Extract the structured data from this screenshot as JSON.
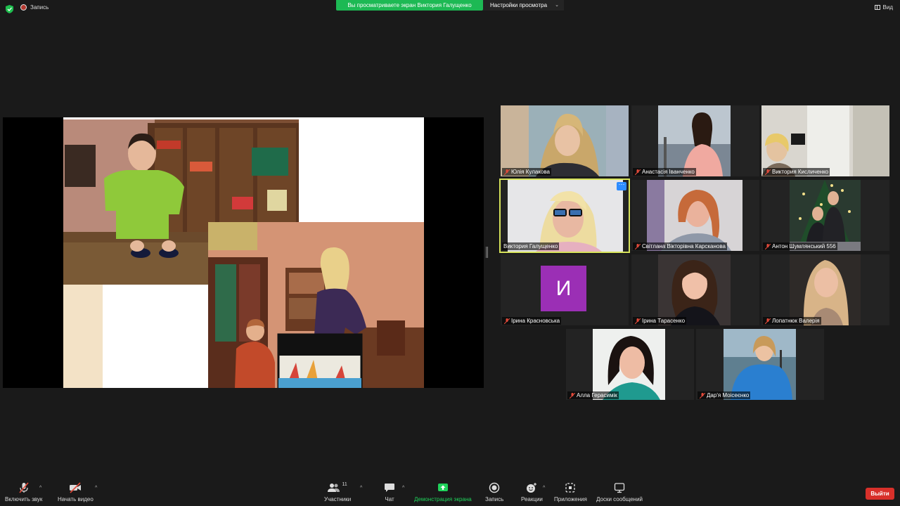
{
  "topbar": {
    "record_label": "Запись",
    "banner": "Вы просматриваете экран Виктория Галущенко",
    "view_options": "Настройки просмотра",
    "view_label": "Вид"
  },
  "participants": [
    {
      "name": "Юлія Кулакова"
    },
    {
      "name": "Анастасія Іванченко"
    },
    {
      "name": "Виктория Кисличенко"
    },
    {
      "name": "Виктория Галущенко"
    },
    {
      "name": "Світлана Вікторівна Карсканова"
    },
    {
      "name": "Антон Шумлянський 556"
    },
    {
      "name": "Ірина Красновська",
      "avatar_letter": "И"
    },
    {
      "name": "Ірина Тарасенко"
    },
    {
      "name": "Лопатнюк Валерія"
    },
    {
      "name": "Алла Герасимік"
    },
    {
      "name": "Дар'я Моісеєнко"
    }
  ],
  "toolbar": {
    "mute_label": "Включить звук",
    "video_label": "Начать видео",
    "participants_label": "Участники",
    "participants_count": "11",
    "chat_label": "Чат",
    "share_label": "Демонстрация экрана",
    "record_label": "Запись",
    "reactions_label": "Реакции",
    "apps_label": "Приложения",
    "whiteboard_label": "Доски сообщений",
    "leave_label": "Выйти"
  },
  "colors": {
    "banner": "#1db954",
    "share_active": "#1fd15a",
    "leave": "#d8302a",
    "active_speaker_border": "#d6e25a",
    "avatar_bg": "#9b2fb5"
  }
}
